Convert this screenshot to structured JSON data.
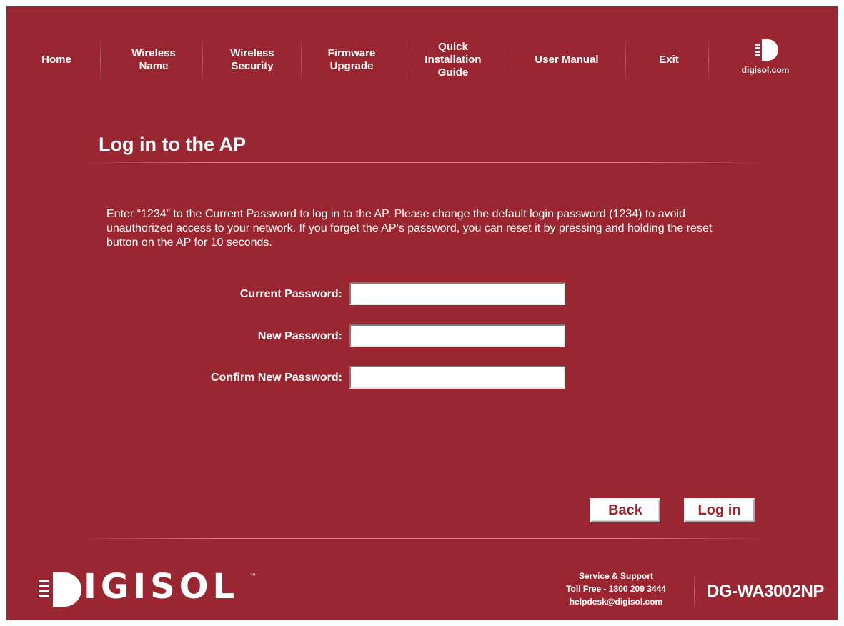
{
  "nav": {
    "items": [
      {
        "label": "Home"
      },
      {
        "label": "Wireless\nName"
      },
      {
        "label": "Wireless\nSecurity"
      },
      {
        "label": "Firmware\nUpgrade"
      },
      {
        "label": "Quick\nInstallation\nGuide"
      },
      {
        "label": "User Manual"
      },
      {
        "label": "Exit"
      }
    ],
    "logo_text": "digisol.com"
  },
  "page": {
    "title": "Log in to the AP",
    "description": "Enter “1234” to the Current Password to log in to the AP. Please change the default login password (1234) to avoid unauthorized access to your network. If you forget the AP’s password, you can reset it by pressing and holding the reset button on the AP for 10 seconds."
  },
  "form": {
    "current_password_label": "Current Password:",
    "current_password_value": "",
    "new_password_label": "New Password:",
    "new_password_value": "",
    "confirm_password_label": "Confirm New Password:",
    "confirm_password_value": ""
  },
  "buttons": {
    "back": "Back",
    "login": "Log in"
  },
  "footer": {
    "brand": "IGISOL",
    "trademark": "™",
    "support_title": "Service & Support",
    "support_phone": "Toll Free - 1800 209 3444",
    "support_email": "helpdesk@digisol.com",
    "model": "DG-WA3002NP"
  },
  "colors": {
    "background": "#9a2631",
    "text": "#ffffff",
    "button_text": "#9a2631"
  }
}
